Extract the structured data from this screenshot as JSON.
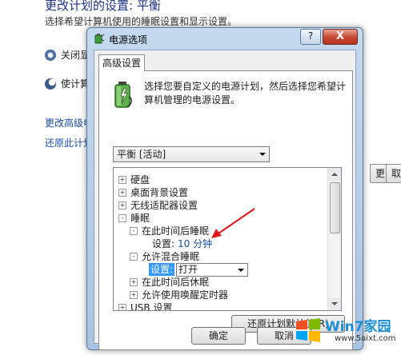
{
  "background": {
    "title": "更改计划的设置: 平衡",
    "subtitle": "选择希望计算机使用的睡眠设置和显示设置。",
    "rows": [
      {
        "label": "关闭显示"
      },
      {
        "label": "使计算机"
      }
    ],
    "links": [
      "更改高级电源",
      "还原此计划的默"
    ],
    "buttons": [
      "更",
      "取"
    ],
    "watermark": {
      "brand": "Win7家园",
      "url": "www.5aixt.com"
    }
  },
  "dialog": {
    "title": "电源选项",
    "help_label": "?",
    "close_label": "X",
    "tab_label": "高级设置",
    "description": "选择您要自定义的电源计划，然后选择您希望计算机管理的电源设置。",
    "plan_select": "平衡 [活动]",
    "tree": {
      "items": [
        {
          "toggle": "+",
          "label": "硬盘"
        },
        {
          "toggle": "+",
          "label": "桌面背景设置"
        },
        {
          "toggle": "+",
          "label": "无线适配器设置"
        },
        {
          "toggle": "-",
          "label": "睡眠"
        },
        {
          "toggle": "-",
          "label": "在此时间后睡眠"
        },
        {
          "toggle": "",
          "label": "设置:",
          "value": "10 分钟"
        },
        {
          "toggle": "-",
          "label": "允许混合睡眠"
        },
        {
          "toggle": "",
          "label": "设置:",
          "value": "打开"
        },
        {
          "toggle": "+",
          "label": "在此时间后休眠"
        },
        {
          "toggle": "+",
          "label": "允许使用唤醒定时器"
        },
        {
          "toggle": "+",
          "label": "USB 设置"
        }
      ]
    },
    "restore_button": "还原计划默认值(R)",
    "ok_button": "确定",
    "cancel_button": "取消"
  },
  "colors": {
    "accent": "#1e3287",
    "link": "#1a4fa3",
    "selection": "#3399ff",
    "annotation_arrow": "#e0161c"
  }
}
